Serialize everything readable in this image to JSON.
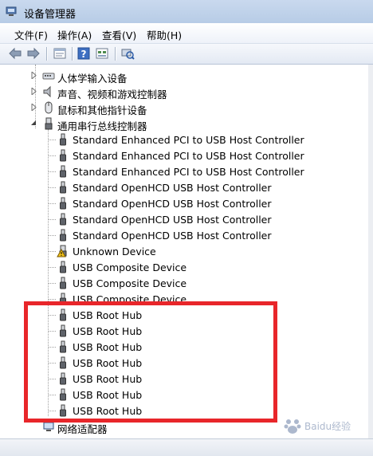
{
  "window": {
    "title": "设备管理器",
    "icon": "device-manager-icon"
  },
  "menu": [
    {
      "label": "文件(F)"
    },
    {
      "label": "操作(A)"
    },
    {
      "label": "查看(V)"
    },
    {
      "label": "帮助(H)"
    }
  ],
  "toolbar": [
    {
      "icon": "back-arrow-icon"
    },
    {
      "icon": "forward-arrow-icon"
    },
    {
      "icon": "properties-icon"
    },
    {
      "icon": "help-icon"
    },
    {
      "icon": "view-icon"
    },
    {
      "icon": "scan-hardware-icon"
    }
  ],
  "tree": {
    "categories": [
      {
        "label": "人体学输入设备",
        "icon": "hid-icon",
        "expanded": false
      },
      {
        "label": "声音、视频和游戏控制器",
        "icon": "speaker-icon",
        "expanded": false
      },
      {
        "label": "鼠标和其他指针设备",
        "icon": "mouse-icon",
        "expanded": false
      },
      {
        "label": "通用串行总线控制器",
        "icon": "usb-controller-icon",
        "expanded": true
      }
    ],
    "usb_children": [
      {
        "label": "Standard Enhanced PCI to USB Host Controller",
        "icon": "usb-plug-icon"
      },
      {
        "label": "Standard Enhanced PCI to USB Host Controller",
        "icon": "usb-plug-icon"
      },
      {
        "label": "Standard Enhanced PCI to USB Host Controller",
        "icon": "usb-plug-icon"
      },
      {
        "label": "Standard OpenHCD USB Host Controller",
        "icon": "usb-plug-icon"
      },
      {
        "label": "Standard OpenHCD USB Host Controller",
        "icon": "usb-plug-icon"
      },
      {
        "label": "Standard OpenHCD USB Host Controller",
        "icon": "usb-plug-icon"
      },
      {
        "label": "Standard OpenHCD USB Host Controller",
        "icon": "usb-plug-icon"
      },
      {
        "label": "Unknown Device",
        "icon": "warning-device-icon"
      },
      {
        "label": "USB Composite Device",
        "icon": "usb-plug-icon"
      },
      {
        "label": "USB Composite Device",
        "icon": "usb-plug-icon"
      },
      {
        "label": "USB Composite Device",
        "icon": "usb-plug-icon"
      },
      {
        "label": "USB Root Hub",
        "icon": "usb-plug-icon"
      },
      {
        "label": "USB Root Hub",
        "icon": "usb-plug-icon"
      },
      {
        "label": "USB Root Hub",
        "icon": "usb-plug-icon"
      },
      {
        "label": "USB Root Hub",
        "icon": "usb-plug-icon"
      },
      {
        "label": "USB Root Hub",
        "icon": "usb-plug-icon"
      },
      {
        "label": "USB Root Hub",
        "icon": "usb-plug-icon"
      },
      {
        "label": "USB Root Hub",
        "icon": "usb-plug-icon"
      }
    ],
    "trailing_category": {
      "label": "网络适配器",
      "icon": "network-adapter-icon",
      "expanded": false
    }
  },
  "annotation": {
    "color": "#e8262a",
    "watermark_text": "Baidu经验"
  }
}
